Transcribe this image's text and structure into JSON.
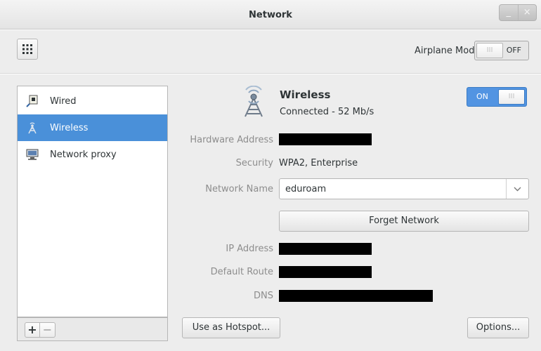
{
  "window": {
    "title": "Network",
    "minimize_glyph": "_",
    "close_glyph": "×"
  },
  "toolbar": {
    "apps_icon": "grid-icon",
    "airplane_label": "Airplane Mode",
    "airplane_toggle": "OFF",
    "toggle_knob_glyph": "III"
  },
  "sidebar": {
    "items": [
      {
        "label": "Wired",
        "icon": "wired-network-icon",
        "selected": false
      },
      {
        "label": "Wireless",
        "icon": "wireless-tower-icon",
        "selected": true
      },
      {
        "label": "Network proxy",
        "icon": "proxy-icon",
        "selected": false
      }
    ],
    "add_label": "+",
    "remove_label": "−"
  },
  "device": {
    "name": "Wireless",
    "status": "Connected - 52 Mb/s",
    "toggle": "ON",
    "toggle_knob_glyph": "III"
  },
  "details": {
    "hardware_label": "Hardware Address",
    "security_label": "Security",
    "security_value": "WPA2, Enterprise",
    "network_label": "Network Name",
    "network_value": "eduroam",
    "forget_label": "Forget Network",
    "ip_label": "IP Address",
    "route_label": "Default Route",
    "dns_label": "DNS"
  },
  "footer": {
    "hotspot_label": "Use as Hotspot...",
    "options_label": "Options..."
  },
  "colors": {
    "accent": "#4a90d9",
    "switch_on": "#5294e2"
  }
}
